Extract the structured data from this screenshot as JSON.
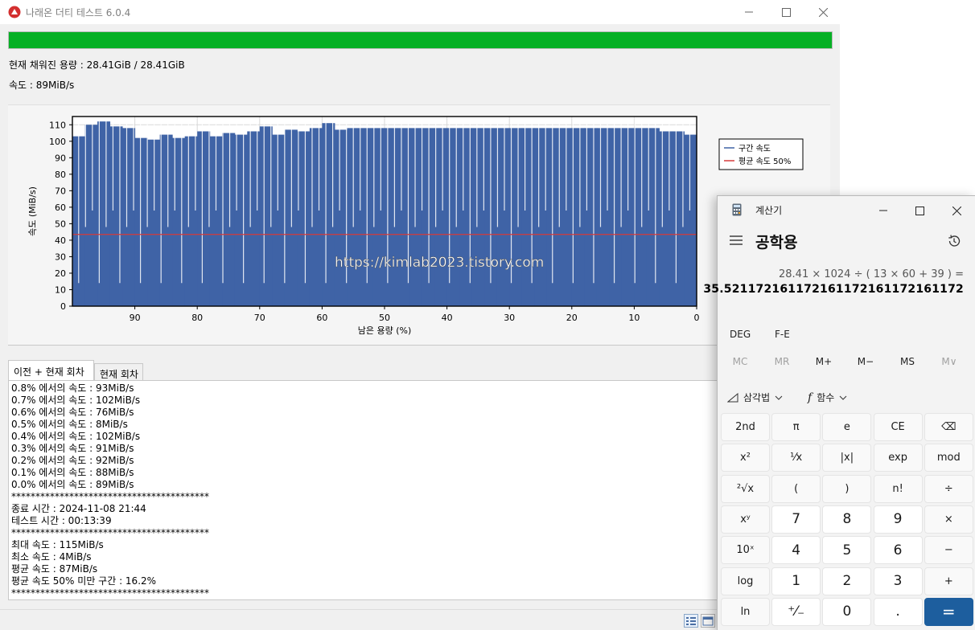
{
  "main": {
    "title": "나래온 더티 테스트 6.0.4",
    "progress_percent": 100,
    "progress_color": "#06b025",
    "capacity_text": "현재 채워진 용량 : 28.41GiB / 28.41GiB",
    "speed_text": "속도 : 89MiB/s",
    "tabs": [
      "이전 + 현재 회차",
      "현재 회차"
    ],
    "log_lines": [
      "0.8% 에서의 속도 : 93MiB/s",
      "0.7% 에서의 속도 : 102MiB/s",
      "0.6% 에서의 속도 : 76MiB/s",
      "0.5% 에서의 속도 : 8MiB/s",
      "0.4% 에서의 속도 : 102MiB/s",
      "0.3% 에서의 속도 : 91MiB/s",
      "0.2% 에서의 속도 : 92MiB/s",
      "0.1% 에서의 속도 : 88MiB/s",
      "0.0% 에서의 속도 : 89MiB/s",
      "*****************************************",
      "종료 시간 : 2024-11-08 21:44",
      "테스트 시간 : 00:13:39",
      "*****************************************",
      "최대 속도 : 115MiB/s",
      "최소 속도 : 4MiB/s",
      "평균 속도 : 87MiB/s",
      "평균 속도 50% 미만 구간 : 16.2%",
      "*****************************************"
    ]
  },
  "chart_data": {
    "type": "area",
    "xlabel": "남은 용량 (%)",
    "ylabel": "속도 (MiB/s)",
    "xlim": [
      100,
      0
    ],
    "ylim": [
      0,
      115
    ],
    "x_ticks": [
      90,
      80,
      70,
      60,
      50,
      40,
      30,
      20,
      10,
      0
    ],
    "y_ticks": [
      0,
      10,
      20,
      30,
      40,
      50,
      60,
      70,
      80,
      90,
      100,
      110
    ],
    "series": [
      {
        "name": "구간 속도",
        "color": "#3f63a6",
        "x": [
          99,
          97,
          95,
          93,
          91,
          89,
          87,
          85,
          83,
          81,
          79,
          77,
          75,
          73,
          71,
          69,
          67,
          65,
          63,
          61,
          59,
          57,
          55,
          53,
          51,
          49,
          47,
          45,
          43,
          41,
          39,
          37,
          35,
          33,
          31,
          29,
          27,
          25,
          23,
          21,
          19,
          17,
          15,
          13,
          11,
          9,
          7,
          5,
          3,
          1
        ],
        "values": [
          103,
          110,
          112,
          109,
          108,
          102,
          101,
          104,
          102,
          103,
          106,
          103,
          105,
          104,
          106,
          109,
          104,
          107,
          106,
          108,
          111,
          107,
          108,
          108,
          108,
          108,
          108,
          108,
          108,
          108,
          108,
          108,
          108,
          108,
          108,
          108,
          108,
          108,
          108,
          108,
          108,
          108,
          108,
          108,
          108,
          108,
          108,
          106,
          106,
          104
        ]
      },
      {
        "name": "평균 속도 50%",
        "color": "#d63a3a",
        "values": [
          43.5
        ]
      }
    ],
    "legend": "top-right",
    "watermark": "https://kimlab2023.tistory.com"
  },
  "calculator": {
    "title": "계산기",
    "mode": "공학용",
    "expression": "28.41 × 1024 ÷ ( 13 × 60 + 39 ) =",
    "result": "35.521172161172161172161172161172",
    "angle_mode": "DEG",
    "fe": "F-E",
    "memory": [
      "MC",
      "MR",
      "M+",
      "M−",
      "MS",
      "M∨"
    ],
    "trig_label": "삼각법",
    "func_label": "함수",
    "keys": [
      [
        "2nd",
        "π",
        "e",
        "CE",
        "⌫"
      ],
      [
        "x²",
        "¹⁄x",
        "|x|",
        "exp",
        "mod"
      ],
      [
        "²√x",
        "(",
        ")",
        "n!",
        "÷"
      ],
      [
        "xʸ",
        "7",
        "8",
        "9",
        "×"
      ],
      [
        "10ˣ",
        "4",
        "5",
        "6",
        "−"
      ],
      [
        "log",
        "1",
        "2",
        "3",
        "+"
      ],
      [
        "ln",
        "⁺⁄₋",
        "0",
        ".",
        "="
      ]
    ],
    "accent_color": "#1d5e9e"
  }
}
